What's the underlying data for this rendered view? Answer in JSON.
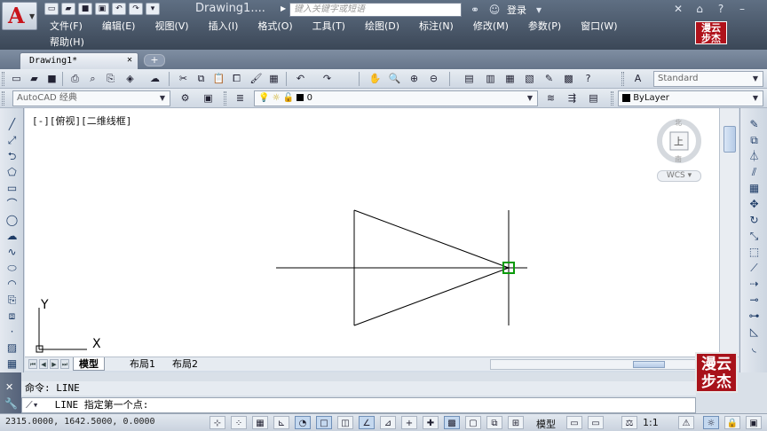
{
  "title": {
    "document": "Drawing1....",
    "search_placeholder": "键入关键字或短语",
    "login": "登录"
  },
  "menus": [
    "文件(F)",
    "编辑(E)",
    "视图(V)",
    "插入(I)",
    "格式(O)",
    "工具(T)",
    "绘图(D)",
    "标注(N)",
    "修改(M)",
    "参数(P)",
    "窗口(W)"
  ],
  "menu_help": "帮助(H)",
  "brand": {
    "line1": "漫云",
    "line2": "步杰"
  },
  "tabs": {
    "document_tab": "Drawing1*"
  },
  "toolbar": {
    "text_style": "Standard",
    "workspace": "AutoCAD 经典",
    "layer_name": "0",
    "linetype": "ByLayer"
  },
  "viewport": {
    "label": "[-][俯视][二维线框]",
    "viewcube_top": "北",
    "viewcube_bottom": "南",
    "viewcube_face": "上",
    "wcs": "WCS",
    "ucs_x": "X",
    "ucs_y": "Y"
  },
  "layout_tabs": [
    "模型",
    "布局1",
    "布局2"
  ],
  "command": {
    "history": "命令:  LINE",
    "prompt": "LINE 指定第一个点:"
  },
  "status": {
    "coords": "2315.0000, 1642.5000, 0.0000",
    "model": "模型",
    "scale": "1:1"
  }
}
